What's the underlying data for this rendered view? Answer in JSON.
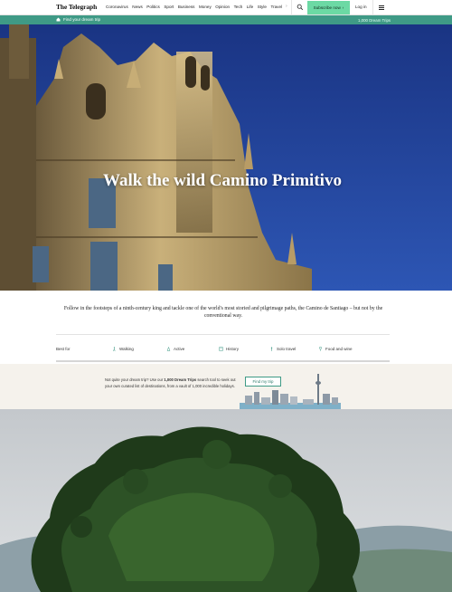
{
  "header": {
    "logo": "The Telegraph",
    "nav_items": [
      "Coronavirus",
      "News",
      "Politics",
      "Sport",
      "Business",
      "Money",
      "Opinion",
      "Tech",
      "Life",
      "Style",
      "Travel"
    ],
    "subscribe_label": "Subscribe now",
    "login_label": "Log in"
  },
  "subbar": {
    "dream_trip_label": "Find your dream trip",
    "trips_count": "1,000 Dream Trips"
  },
  "hero": {
    "title": "Walk the wild Camino Primitivo"
  },
  "intro": {
    "text": "Follow in the footsteps of a ninth-century king and tackle one of the world's most storied and pilgrimage paths, the Camino de Santiago – but not by the conventional way."
  },
  "best_for": {
    "label": "Best for",
    "items": [
      {
        "label": "Walking",
        "icon": "walking-icon"
      },
      {
        "label": "Active",
        "icon": "active-icon"
      },
      {
        "label": "History",
        "icon": "history-icon"
      },
      {
        "label": "Solo travel",
        "icon": "solo-travel-icon"
      },
      {
        "label": "Food and wine",
        "icon": "food-wine-icon"
      }
    ]
  },
  "promo": {
    "text_before": "Not quite your dream trip? Use our ",
    "text_bold": "1,000 Dream Trips",
    "text_after": " search tool to seek out your own curated list of destinations, from a vault of 1,000 incredible holidays.",
    "button_label": "Find my trip"
  },
  "colors": {
    "accent_green": "#3f9a86",
    "subscribe_green": "#6cd9a4",
    "sky_blue": "#1e3a8c",
    "promo_bg": "#f5f2ec"
  }
}
